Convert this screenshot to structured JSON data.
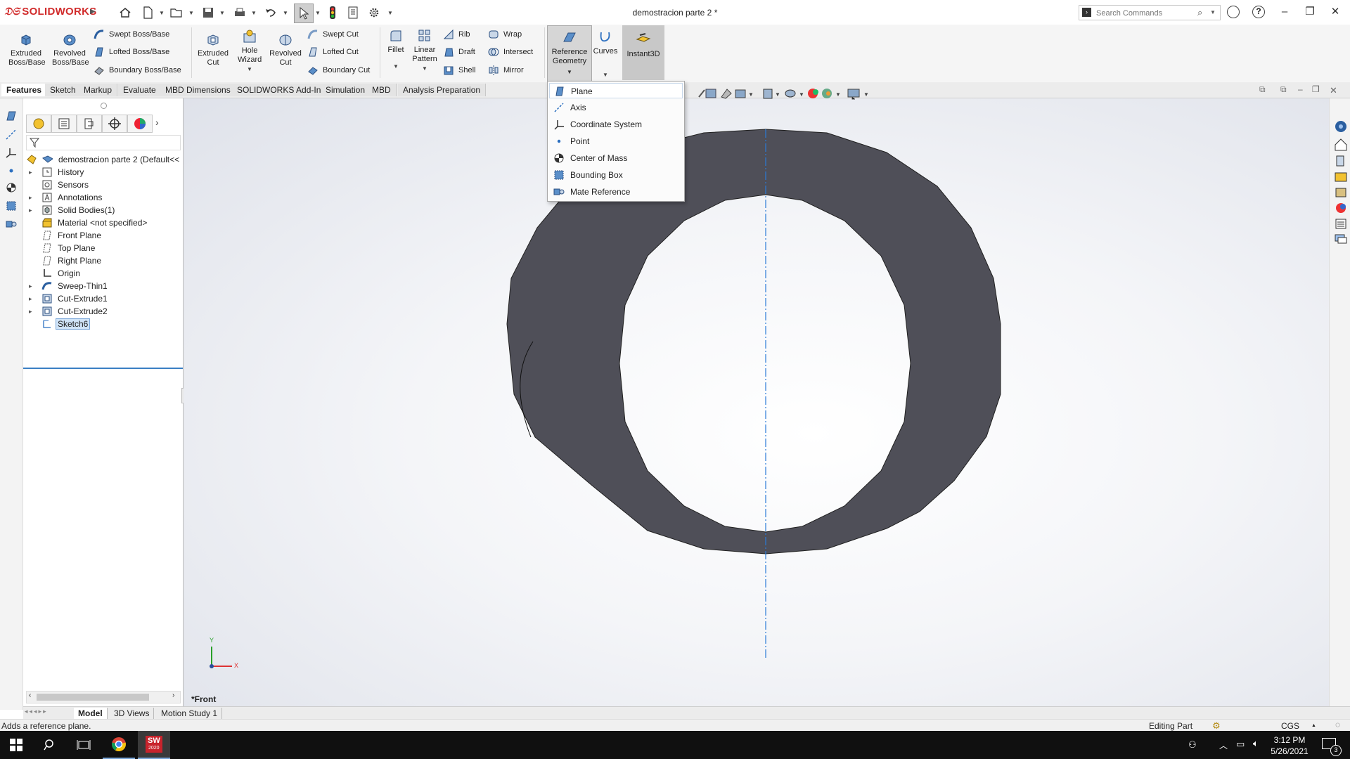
{
  "app": {
    "brand": "SOLIDWORKS",
    "document_title": "demostracion parte 2 *",
    "search_placeholder": "Search Commands"
  },
  "colors": {
    "accent_red": "#d12b2b",
    "part_fill": "#4f4f58",
    "centerline": "#2b7bd8",
    "selection": "#cfe3f7",
    "taskbar": "#101010"
  },
  "commands": {
    "extruded_boss": "Extruded Boss/Base",
    "revolved_boss": "Revolved Boss/Base",
    "swept_boss": "Swept Boss/Base",
    "lofted_boss": "Lofted Boss/Base",
    "boundary_boss": "Boundary Boss/Base",
    "extruded_cut": "Extruded Cut",
    "hole_wizard": "Hole Wizard",
    "revolved_cut": "Revolved Cut",
    "swept_cut": "Swept Cut",
    "lofted_cut": "Lofted Cut",
    "boundary_cut": "Boundary Cut",
    "fillet": "Fillet",
    "linear_pattern": "Linear Pattern",
    "rib": "Rib",
    "draft": "Draft",
    "shell": "Shell",
    "wrap": "Wrap",
    "intersect": "Intersect",
    "mirror": "Mirror",
    "reference_geometry": "Reference Geometry",
    "curves": "Curves",
    "instant3d": "Instant3D"
  },
  "tabs": [
    "Features",
    "Sketch",
    "Markup",
    "Evaluate",
    "MBD Dimensions",
    "SOLIDWORKS Add-Ins",
    "Simulation",
    "MBD",
    "Analysis Preparation"
  ],
  "refgeo_menu": [
    "Plane",
    "Axis",
    "Coordinate System",
    "Point",
    "Center of Mass",
    "Bounding Box",
    "Mate Reference"
  ],
  "tree": {
    "root": "demostracion parte 2  (Default<<",
    "items": [
      {
        "label": "History",
        "expand": "▸",
        "icon": "history-icon"
      },
      {
        "label": "Sensors",
        "expand": "",
        "icon": "sensors-icon"
      },
      {
        "label": "Annotations",
        "expand": "▸",
        "icon": "annotations-icon"
      },
      {
        "label": "Solid Bodies(1)",
        "expand": "▸",
        "icon": "solid-bodies-icon"
      },
      {
        "label": "Material <not specified>",
        "expand": "",
        "icon": "material-icon"
      },
      {
        "label": "Front Plane",
        "expand": "",
        "icon": "plane-icon"
      },
      {
        "label": "Top Plane",
        "expand": "",
        "icon": "plane-icon"
      },
      {
        "label": "Right Plane",
        "expand": "",
        "icon": "plane-icon"
      },
      {
        "label": "Origin",
        "expand": "",
        "icon": "origin-icon"
      },
      {
        "label": "Sweep-Thin1",
        "expand": "▸",
        "icon": "sweep-icon"
      },
      {
        "label": "Cut-Extrude1",
        "expand": "▸",
        "icon": "cut-extrude-icon"
      },
      {
        "label": "Cut-Extrude2",
        "expand": "▸",
        "icon": "cut-extrude-icon"
      },
      {
        "label": "Sketch6",
        "expand": "",
        "icon": "sketch-icon"
      }
    ]
  },
  "viewport": {
    "view_label": "*Front",
    "triad_y": "Y",
    "triad_x": "X"
  },
  "bottom_tabs": [
    "Model",
    "3D Views",
    "Motion Study 1"
  ],
  "status": {
    "message": "Adds a reference plane.",
    "mode": "Editing Part",
    "units": "CGS"
  },
  "taskbar": {
    "time": "3:12 PM",
    "date": "5/26/2021",
    "sw_badge": "SW",
    "sw_year": "2020",
    "notification_count": "3"
  }
}
